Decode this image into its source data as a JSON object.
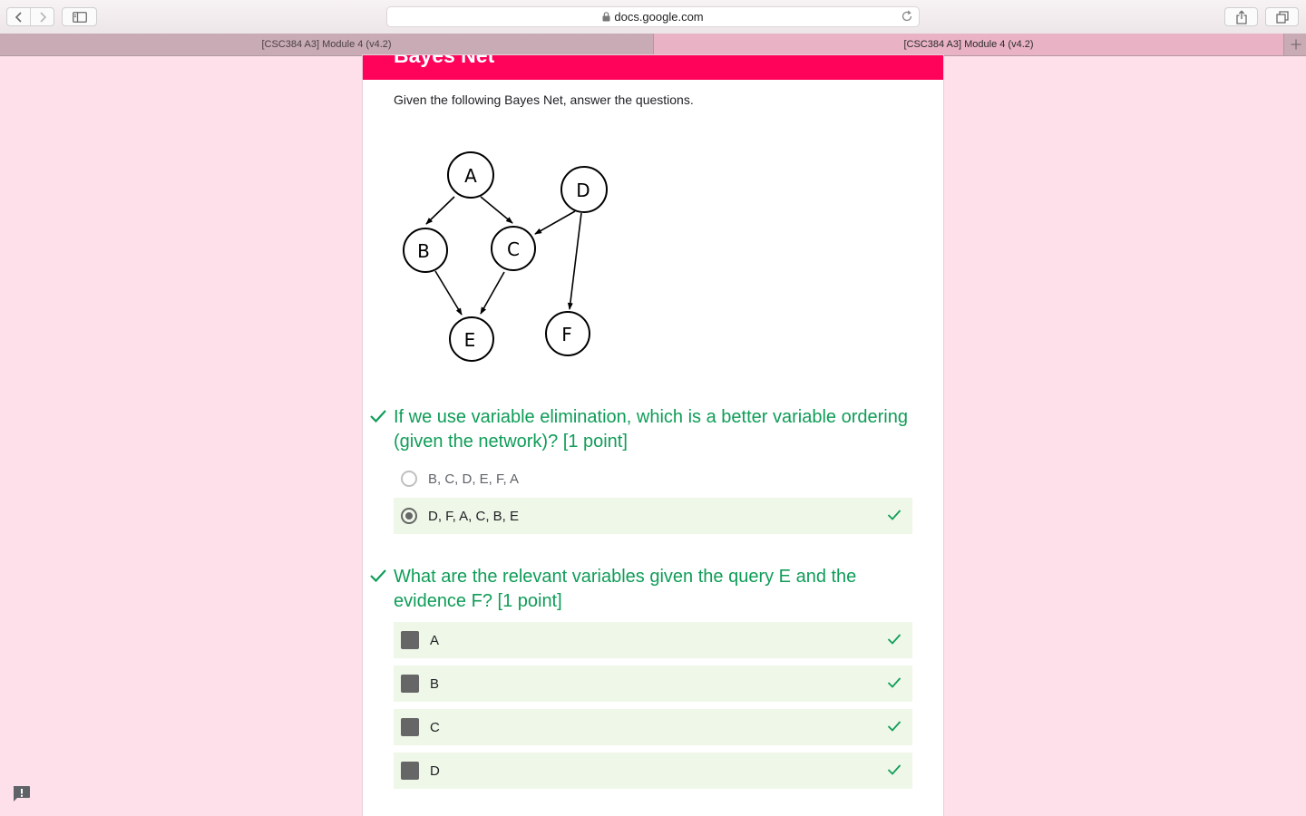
{
  "browser": {
    "url": "docs.google.com",
    "tabs": [
      {
        "label": "[CSC384 A3] Module 4 (v4.2)",
        "active": false
      },
      {
        "label": "[CSC384 A3] Module 4 (v4.2)",
        "active": true
      }
    ]
  },
  "form": {
    "section_title": "Bayes Net",
    "description": "Given the following Bayes Net, answer the questions.",
    "accent_color": "#ff0259",
    "correct_color": "#0f9d58",
    "diagram": {
      "nodes": [
        "A",
        "B",
        "C",
        "D",
        "E",
        "F"
      ],
      "edges": [
        [
          "A",
          "B"
        ],
        [
          "A",
          "C"
        ],
        [
          "D",
          "C"
        ],
        [
          "D",
          "F"
        ],
        [
          "B",
          "E"
        ],
        [
          "C",
          "E"
        ]
      ]
    },
    "questions": [
      {
        "title": "If we use variable elimination, which is a better variable ordering (given the network)? [1 point]",
        "type": "radio",
        "options": [
          {
            "label": "B, C, D, E, F, A",
            "selected": false,
            "correct": false
          },
          {
            "label": "D, F, A, C, B, E",
            "selected": true,
            "correct": true
          }
        ]
      },
      {
        "title": "What are the relevant variables given the query E and the evidence F? [1 point]",
        "type": "checkbox",
        "options": [
          {
            "label": "A",
            "checked": true,
            "correct": true
          },
          {
            "label": "B",
            "checked": true,
            "correct": true
          },
          {
            "label": "C",
            "checked": true,
            "correct": true
          },
          {
            "label": "D",
            "checked": true,
            "correct": true
          }
        ]
      }
    ]
  }
}
